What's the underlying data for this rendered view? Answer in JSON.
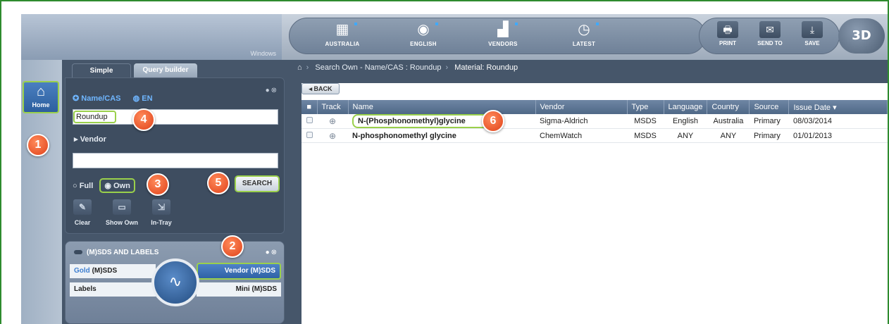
{
  "topbar": {
    "brand_caption": "Windows",
    "nav": [
      {
        "label": "AUSTRALIA",
        "icon": "flag-icon"
      },
      {
        "label": "ENGLISH",
        "icon": "language-icon"
      },
      {
        "label": "VENDORS",
        "icon": "vendors-icon"
      },
      {
        "label": "LATEST",
        "icon": "clock-icon"
      }
    ],
    "actions": [
      {
        "label": "PRINT",
        "icon": "printer-icon",
        "glyph": "🖶"
      },
      {
        "label": "SEND TO",
        "icon": "envelope-icon",
        "glyph": "✉"
      },
      {
        "label": "SAVE",
        "icon": "download-icon",
        "glyph": "⤓"
      }
    ],
    "btn_3d": "3D"
  },
  "rail": {
    "home_label": "Home"
  },
  "tabs": {
    "simple": "Simple",
    "query_builder": "Query builder"
  },
  "search_panel": {
    "mode_name_cas": "Name/CAS",
    "mode_en": "EN",
    "query_value": "Roundup",
    "vendor_label": "Vendor",
    "vendor_value": "",
    "scope_full": "Full",
    "scope_own": "Own",
    "search_button": "SEARCH",
    "tools": [
      {
        "label": "Clear",
        "icon": "eraser-icon"
      },
      {
        "label": "Show Own",
        "icon": "folder-icon"
      },
      {
        "label": "In-Tray",
        "icon": "tray-icon"
      }
    ]
  },
  "sds_panel": {
    "title": "(M)SDS AND LABELS",
    "gold_prefix": "Gold",
    "gold_suffix": "(M)SDS",
    "vendor_msds": "Vendor (M)SDS",
    "labels": "Labels",
    "mini_msds": "Mini (M)SDS"
  },
  "breadcrumb": {
    "level1": "Search Own - Name/CAS : Roundup",
    "level2": "Material: Roundup"
  },
  "results": {
    "back_label": "◂ BACK",
    "columns": [
      "Track",
      "Name",
      "Vendor",
      "Type",
      "Language",
      "Country",
      "Source",
      "Issue Date ▾"
    ],
    "rows": [
      {
        "name": "N-(Phosphonomethyl)glycine",
        "vendor": "Sigma-Aldrich",
        "type": "MSDS",
        "language": "English",
        "country": "Australia",
        "source": "Primary",
        "issue_date": "08/03/2014"
      },
      {
        "name": "N-phosphonomethyl glycine",
        "vendor": "ChemWatch",
        "type": "MSDS",
        "language": "ANY",
        "country": "ANY",
        "source": "Primary",
        "issue_date": "01/01/2013"
      }
    ]
  },
  "callouts": [
    "1",
    "2",
    "3",
    "4",
    "5",
    "6"
  ],
  "colors": {
    "highlight": "#9ad04b",
    "callout": "#e0421a",
    "frame": "#2e8b2e"
  }
}
